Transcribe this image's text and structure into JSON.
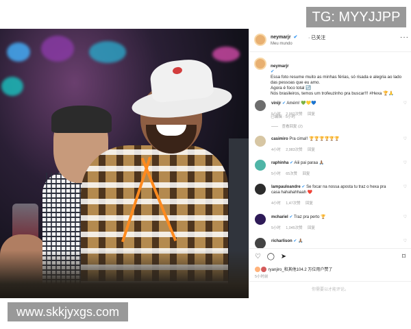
{
  "watermarks": {
    "top_right": "TG: MYYJJPP",
    "bottom_left": "www.skkjyxgs.com"
  },
  "post": {
    "header": {
      "username": "neymarjr",
      "verified_badge": "✔",
      "follow_status": "· 已关注",
      "location": "Meu mundo",
      "more_icon": "···"
    },
    "caption": {
      "username": "neymarjr",
      "text": "Essa foto resume muito as minhas férias, só risada e alegria ao lado das pessoas que eu amo.\nAgora é foco total 🔃\nNós brasileiros, temos um trofeuzinho pra buscar!!! #Hexa 🏆🙏",
      "time": "已编辑 · 5小时"
    },
    "comments": [
      {
        "username": "vinijr",
        "text": "Amém! 💚💛💙",
        "time": "5小时",
        "likes": "2,992次赞",
        "reply": "回复"
      },
      {
        "username": "casimiro",
        "text": "Pra cima!! 🏆🏆🏆🏆🏆🏆",
        "time": "4小时",
        "likes": "2,983次赞",
        "reply": "回复"
      },
      {
        "username": "raphinha",
        "text": "Aiii pai paraa 🙏🏽",
        "time": "5小时",
        "likes": "65次赞",
        "reply": "回复"
      },
      {
        "username": "lampauloandre",
        "text": "Se focar na nossa aposta tu traz o hexa pra casa hahahahhaah ❤️",
        "time": "4小时",
        "likes": "1,47次赞",
        "reply": "回复"
      },
      {
        "username": "mchariel",
        "text": "Traz pra perto 🏆",
        "time": "5小时",
        "likes": "1,045次赞",
        "reply": "回复"
      },
      {
        "username": "richarlison",
        "text": "🙏🏽",
        "time": "",
        "likes": "",
        "reply": ""
      }
    ],
    "replies_link": "查看回复 (2)",
    "actions": {
      "like_icon": "♡",
      "comment_icon": "◯",
      "share_icon": "➤",
      "save_icon": "⌑"
    },
    "likes_text": "ryanjiro_和其他104.2 万位用户赞了",
    "post_time": "5小时前",
    "add_comment_placeholder": "你需要以才能评论。"
  }
}
